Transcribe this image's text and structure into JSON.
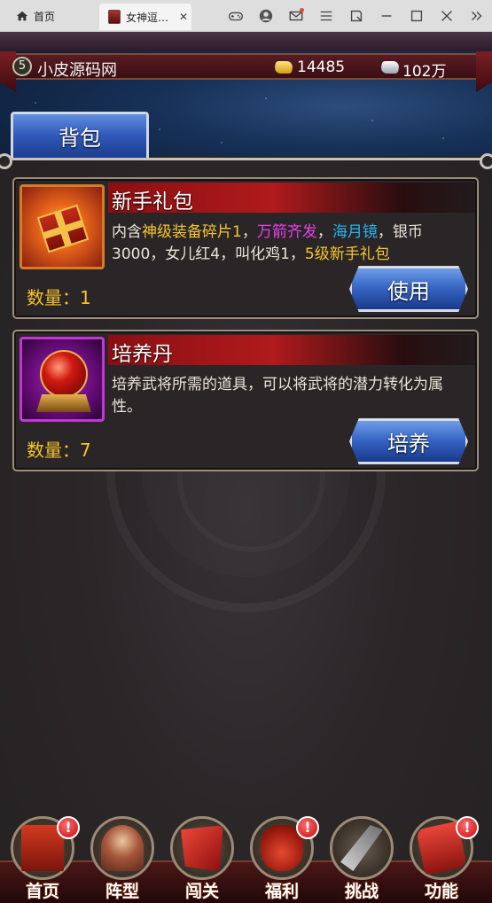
{
  "browser": {
    "home_tab_label": "首页",
    "game_tab_title": "女神逗…"
  },
  "header": {
    "level": "5",
    "player_name": "小皮源码网",
    "gold": "14485",
    "silver": "102万"
  },
  "tabs": {
    "bag_label": "背包"
  },
  "items": [
    {
      "name": "新手礼包",
      "desc_parts": [
        {
          "text": "内含",
          "color": "default"
        },
        {
          "text": "神级装备碎片1",
          "color": "yellow"
        },
        {
          "text": "，",
          "color": "default"
        },
        {
          "text": "万箭齐发",
          "color": "magenta"
        },
        {
          "text": "，",
          "color": "default"
        },
        {
          "text": "海月镜",
          "color": "cyan"
        },
        {
          "text": "，银币3000，女儿红4，叫化鸡1，",
          "color": "default"
        },
        {
          "text": "5级新手礼包",
          "color": "yellow"
        }
      ],
      "quantity": "数量：1",
      "button_label": "使用",
      "icon": "gift-box-icon"
    },
    {
      "name": "培养丹",
      "desc_parts": [
        {
          "text": "培养武将所需的道具，可以将武将的潜力转化为属性。",
          "color": "default"
        }
      ],
      "quantity": "数量：7",
      "button_label": "培养",
      "icon": "red-orb-icon"
    }
  ],
  "bottom_nav": [
    {
      "label": "首页",
      "badge": "!"
    },
    {
      "label": "阵型",
      "badge": ""
    },
    {
      "label": "闯关",
      "badge": ""
    },
    {
      "label": "福利",
      "badge": "!"
    },
    {
      "label": "挑战",
      "badge": ""
    },
    {
      "label": "功能",
      "badge": "!"
    }
  ],
  "colors": {
    "desc_yellow": "#f7c531",
    "desc_magenta": "#e640e8",
    "desc_cyan": "#29b4ee",
    "quantity_gold": "#f6c42a"
  }
}
